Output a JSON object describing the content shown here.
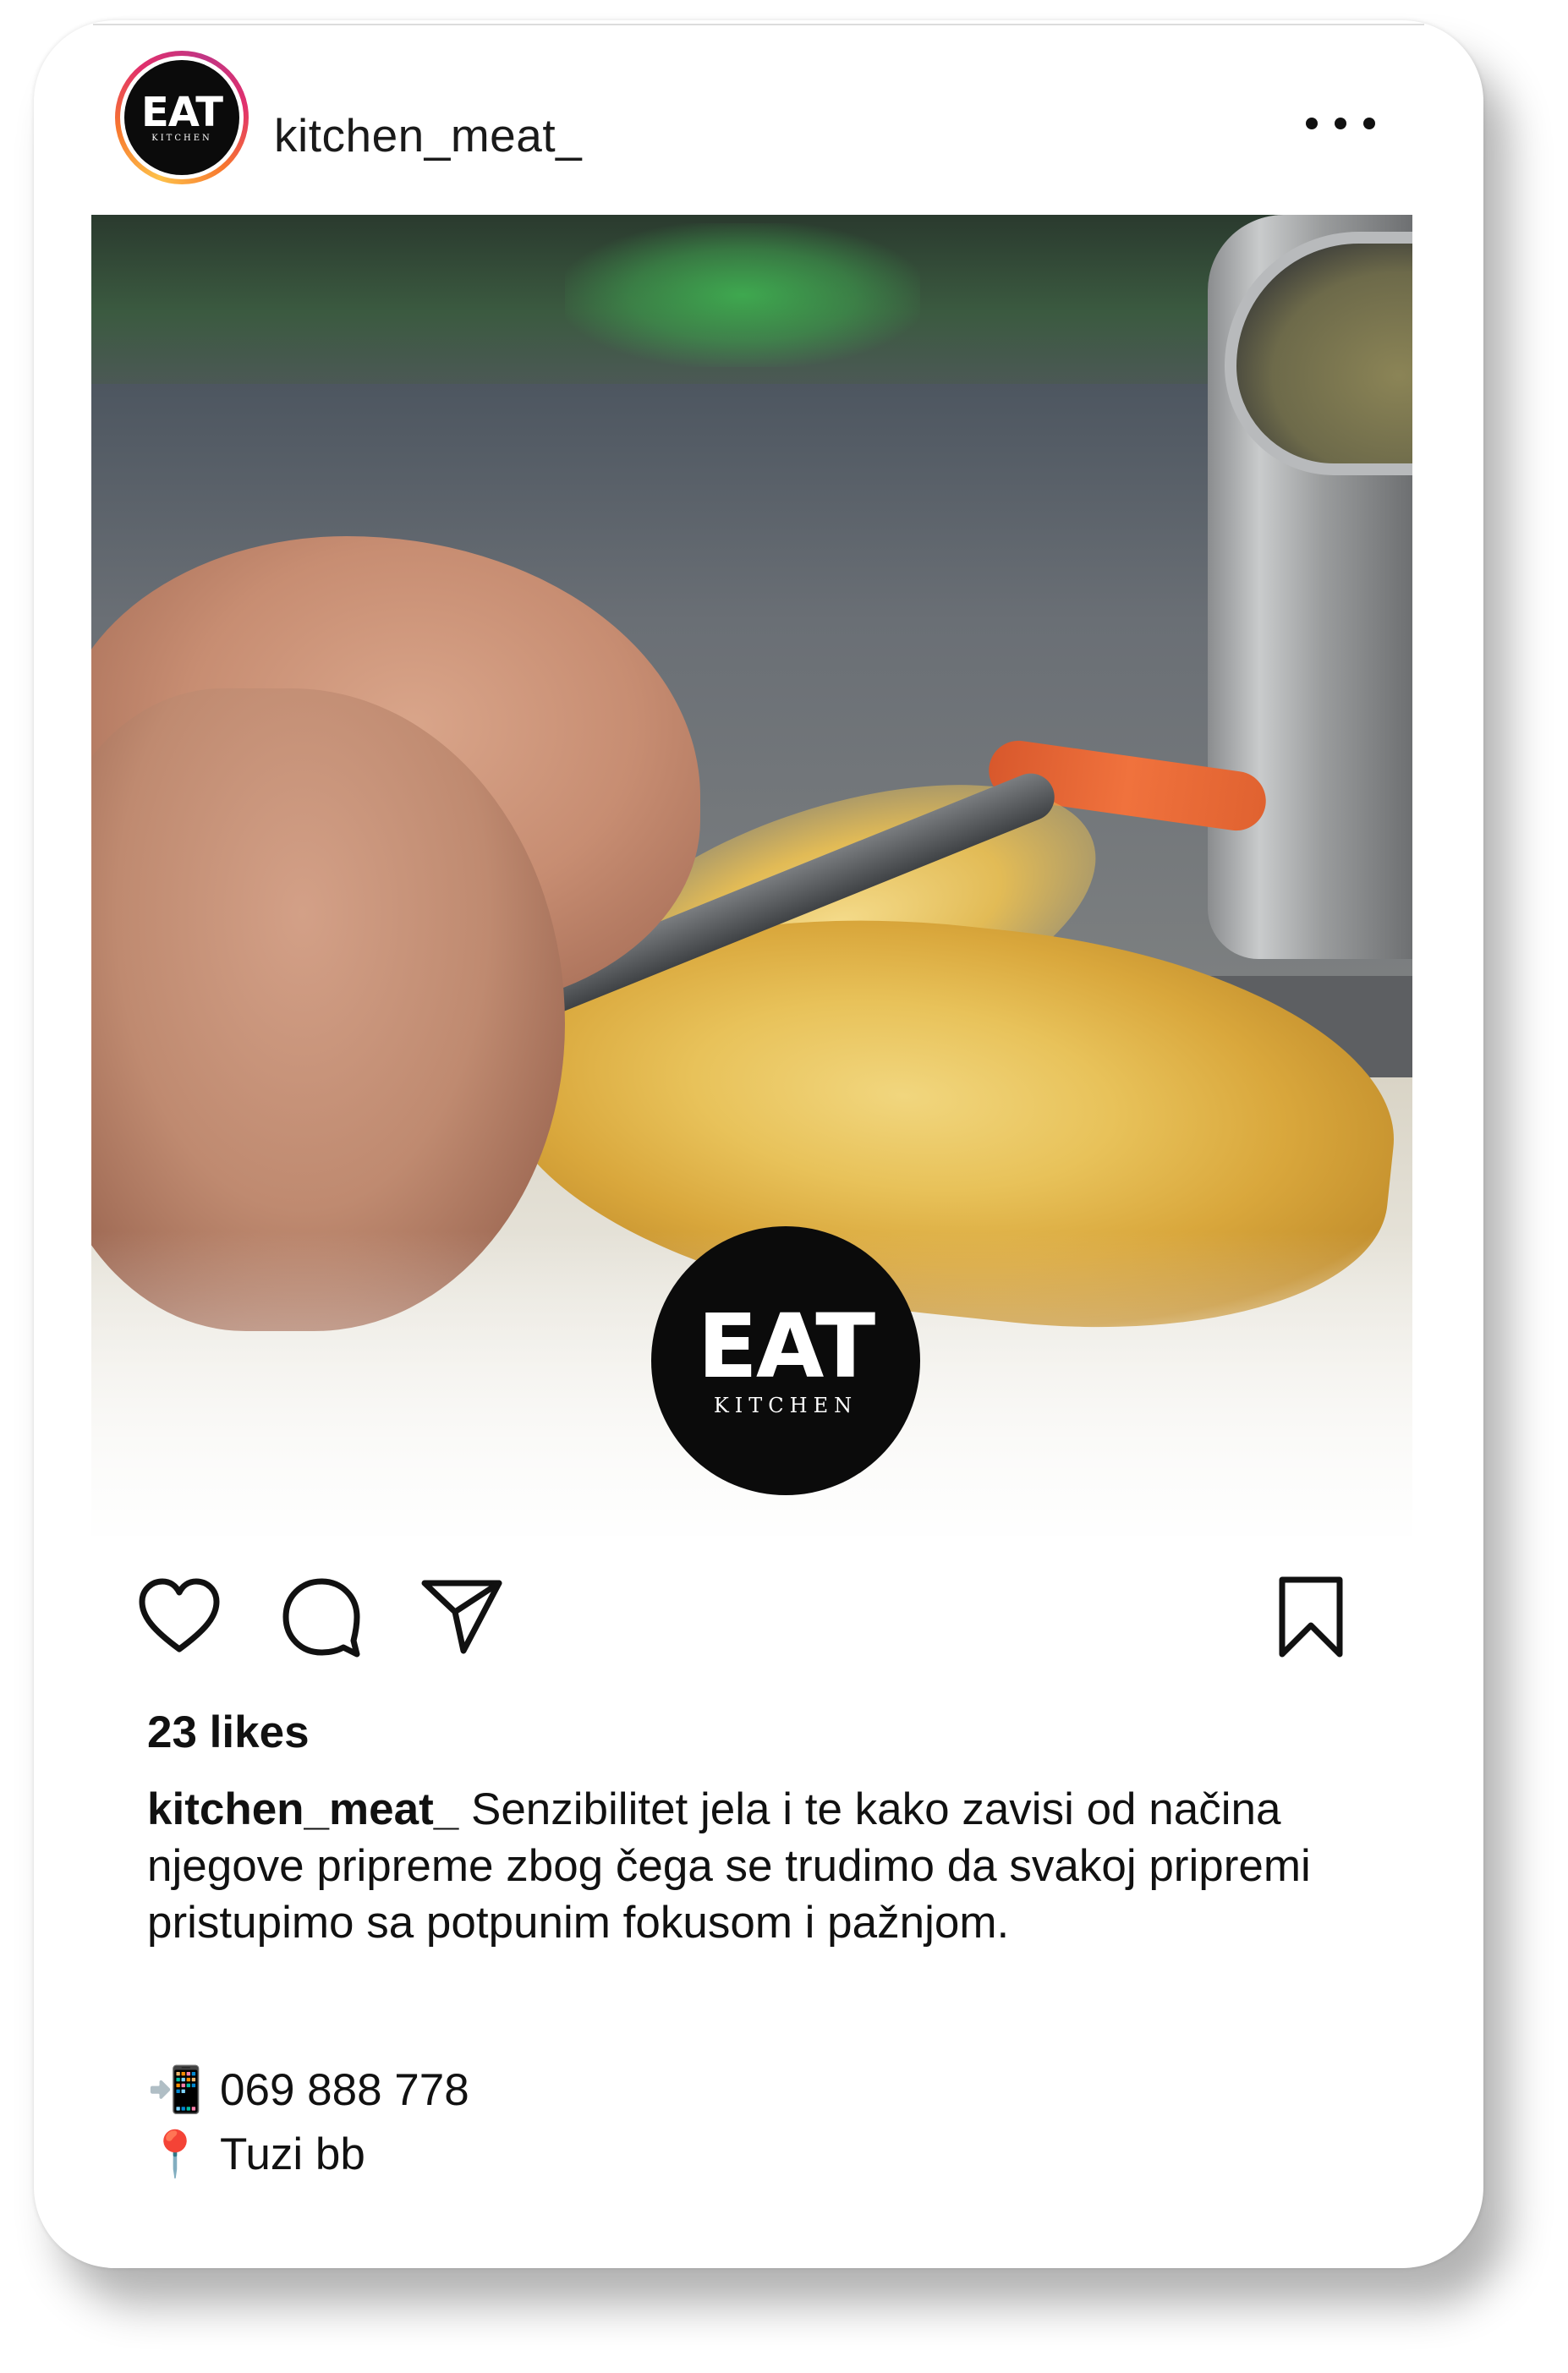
{
  "post": {
    "username": "kitchen_meat_",
    "avatar": {
      "logo_word": "EAT",
      "logo_sub": "KITCHEN"
    },
    "more_icon": "more-horizontal-icon",
    "image_badge": {
      "logo_word": "EAT",
      "logo_sub": "KITCHEN"
    },
    "actions": {
      "like_icon": "heart-icon",
      "comment_icon": "speech-bubble-icon",
      "share_icon": "paper-plane-icon",
      "save_icon": "bookmark-icon"
    },
    "likes_text": "23 likes",
    "caption": {
      "user": "kitchen_meat_",
      "text": "Senzibilitet jela i te kako zavisi od načina njegove pripreme zbog čega se trudimo da svakoj pripremi pristupimo sa potpunim fokusom i pažnjom."
    },
    "contact": {
      "phone_emoji": "📲",
      "phone": "069 888 778",
      "location_emoji": "📍",
      "address": "Tuzi bb"
    }
  },
  "colors": {
    "text": "#111111",
    "background": "#ffffff",
    "logo_bg": "#0b0b0b",
    "story_ring": [
      "#fdc14a",
      "#f7772e",
      "#e1306c",
      "#c13584"
    ]
  }
}
